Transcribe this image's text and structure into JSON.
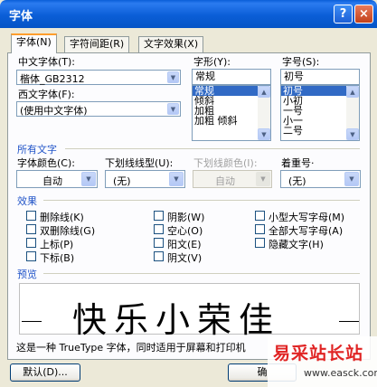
{
  "window": {
    "title": "字体",
    "help_icon": "?",
    "close_icon": "×"
  },
  "tabs": [
    {
      "label": "字体(N)",
      "active": true
    },
    {
      "label": "字符间距(R)",
      "active": false
    },
    {
      "label": "文字效果(X)",
      "active": false
    }
  ],
  "chinese_font": {
    "label": "中文字体(T):",
    "value": "楷体_GB2312"
  },
  "western_font": {
    "label": "西文字体(F):",
    "value": "(使用中文字体)"
  },
  "font_style": {
    "label": "字形(Y):",
    "value": "常规",
    "options": [
      "常规",
      "倾斜",
      "加粗",
      "加粗 倾斜"
    ],
    "selected": "常规"
  },
  "font_size": {
    "label": "字号(S):",
    "value": "初号",
    "options": [
      "初号",
      "小初",
      "一号",
      "小一",
      "二号"
    ],
    "selected": "初号"
  },
  "all_text": {
    "section_label": "所有文字",
    "font_color": {
      "label": "字体颜色(C):",
      "value": "自动"
    },
    "underline_style": {
      "label": "下划线线型(U):",
      "value": "(无)"
    },
    "underline_color": {
      "label": "下划线颜色(I):",
      "value": "自动",
      "disabled": true
    },
    "emphasis": {
      "label": "着重号·",
      "value": "(无)"
    }
  },
  "effects": {
    "section_label": "效果",
    "items": [
      {
        "label": "删除线(K)",
        "checked": false
      },
      {
        "label": "双删除线(G)",
        "checked": false
      },
      {
        "label": "上标(P)",
        "checked": false
      },
      {
        "label": "下标(B)",
        "checked": false
      },
      {
        "label": "阴影(W)",
        "checked": false
      },
      {
        "label": "空心(O)",
        "checked": false
      },
      {
        "label": "阳文(E)",
        "checked": false
      },
      {
        "label": "阴文(V)",
        "checked": false
      },
      {
        "label": "小型大写字母(M)",
        "checked": false
      },
      {
        "label": "全部大写字母(A)",
        "checked": false
      },
      {
        "label": "隐藏文字(H)",
        "checked": false
      }
    ]
  },
  "preview": {
    "section_label": "预览",
    "sample_text": "快乐小荣佳",
    "note": "这是一种 TrueType 字体，同时适用于屏幕和打印机"
  },
  "buttons": {
    "default": "默认(D)...",
    "ok": "确"
  },
  "watermark": {
    "brand": "易采站长站",
    "url": "www.easck.com"
  },
  "colors": {
    "titlebar": "#0b5ed7",
    "dialog_bg": "#ece9d8",
    "section_text": "#2154c8",
    "selection": "#316ac5",
    "watermark_red": "#e02424"
  }
}
